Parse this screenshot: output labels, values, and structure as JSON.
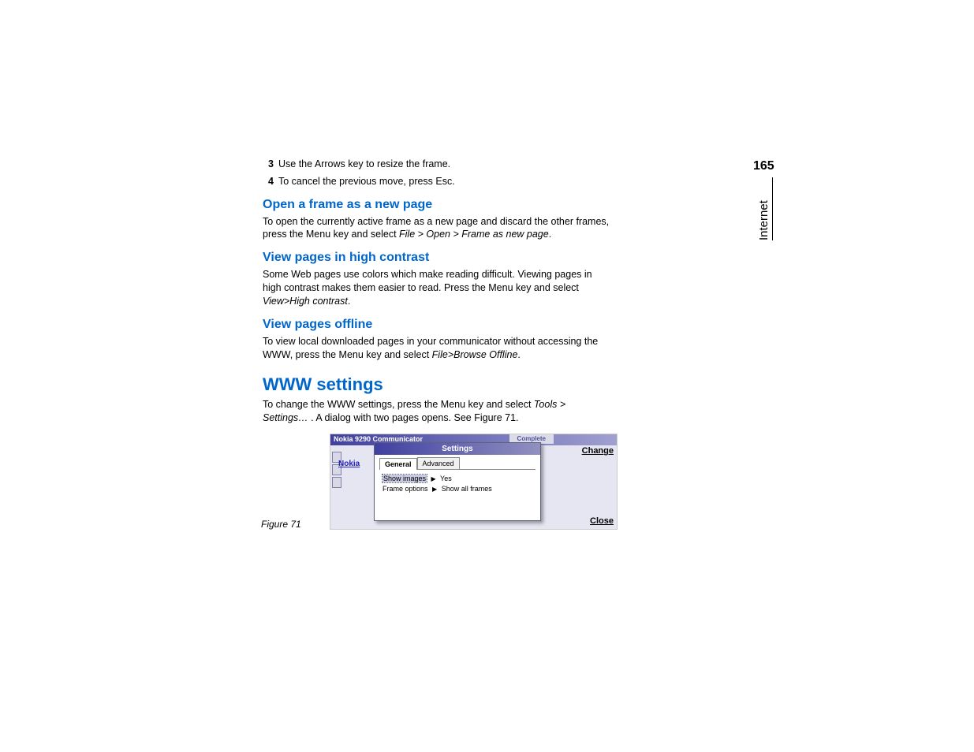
{
  "pageNumber": "165",
  "sideTab": "Internet",
  "steps": [
    {
      "num": "3",
      "text": "Use the Arrows key to resize the frame."
    },
    {
      "num": "4",
      "text": "To cancel the previous move, press Esc."
    }
  ],
  "sections": [
    {
      "heading": "Open a frame as a new page",
      "level": "h3",
      "paragraphs": [
        {
          "pre": "To open the currently active frame as a new page and discard the other frames, press the Menu key and select ",
          "em": "File > Open > Frame as new page",
          "post": "."
        }
      ]
    },
    {
      "heading": "View pages in high contrast",
      "level": "h3",
      "paragraphs": [
        {
          "pre": "Some Web pages use colors which make reading difficult. Viewing pages in high contrast makes them easier to read. Press the Menu key and select ",
          "em": "View>High contrast",
          "post": "."
        }
      ]
    },
    {
      "heading": "View pages offline",
      "level": "h3",
      "paragraphs": [
        {
          "pre": "To view local downloaded pages in your communicator without accessing the WWW, press the Menu key and select ",
          "em": "File>Browse Offline",
          "post": "."
        }
      ]
    },
    {
      "heading": "WWW settings",
      "level": "h2",
      "paragraphs": [
        {
          "pre": "To change the WWW settings, press the Menu key and select ",
          "em": "Tools > Settings…",
          "post": " . A dialog with two pages opens. See Figure 71."
        }
      ]
    }
  ],
  "figure": {
    "caption": "Figure 71",
    "titlebar": "Nokia 9290 Communicator",
    "titlebarStatus": "Complete",
    "nokiaLink": "Nokia",
    "softkeys": {
      "top": "Change",
      "bottom": "Close"
    },
    "dialog": {
      "title": "Settings",
      "tabs": [
        "General",
        "Advanced"
      ],
      "activeTab": 0,
      "rows": [
        {
          "label": "Show images",
          "value": "Yes",
          "selected": true
        },
        {
          "label": "Frame options",
          "value": "Show all frames",
          "selected": false
        }
      ]
    }
  }
}
